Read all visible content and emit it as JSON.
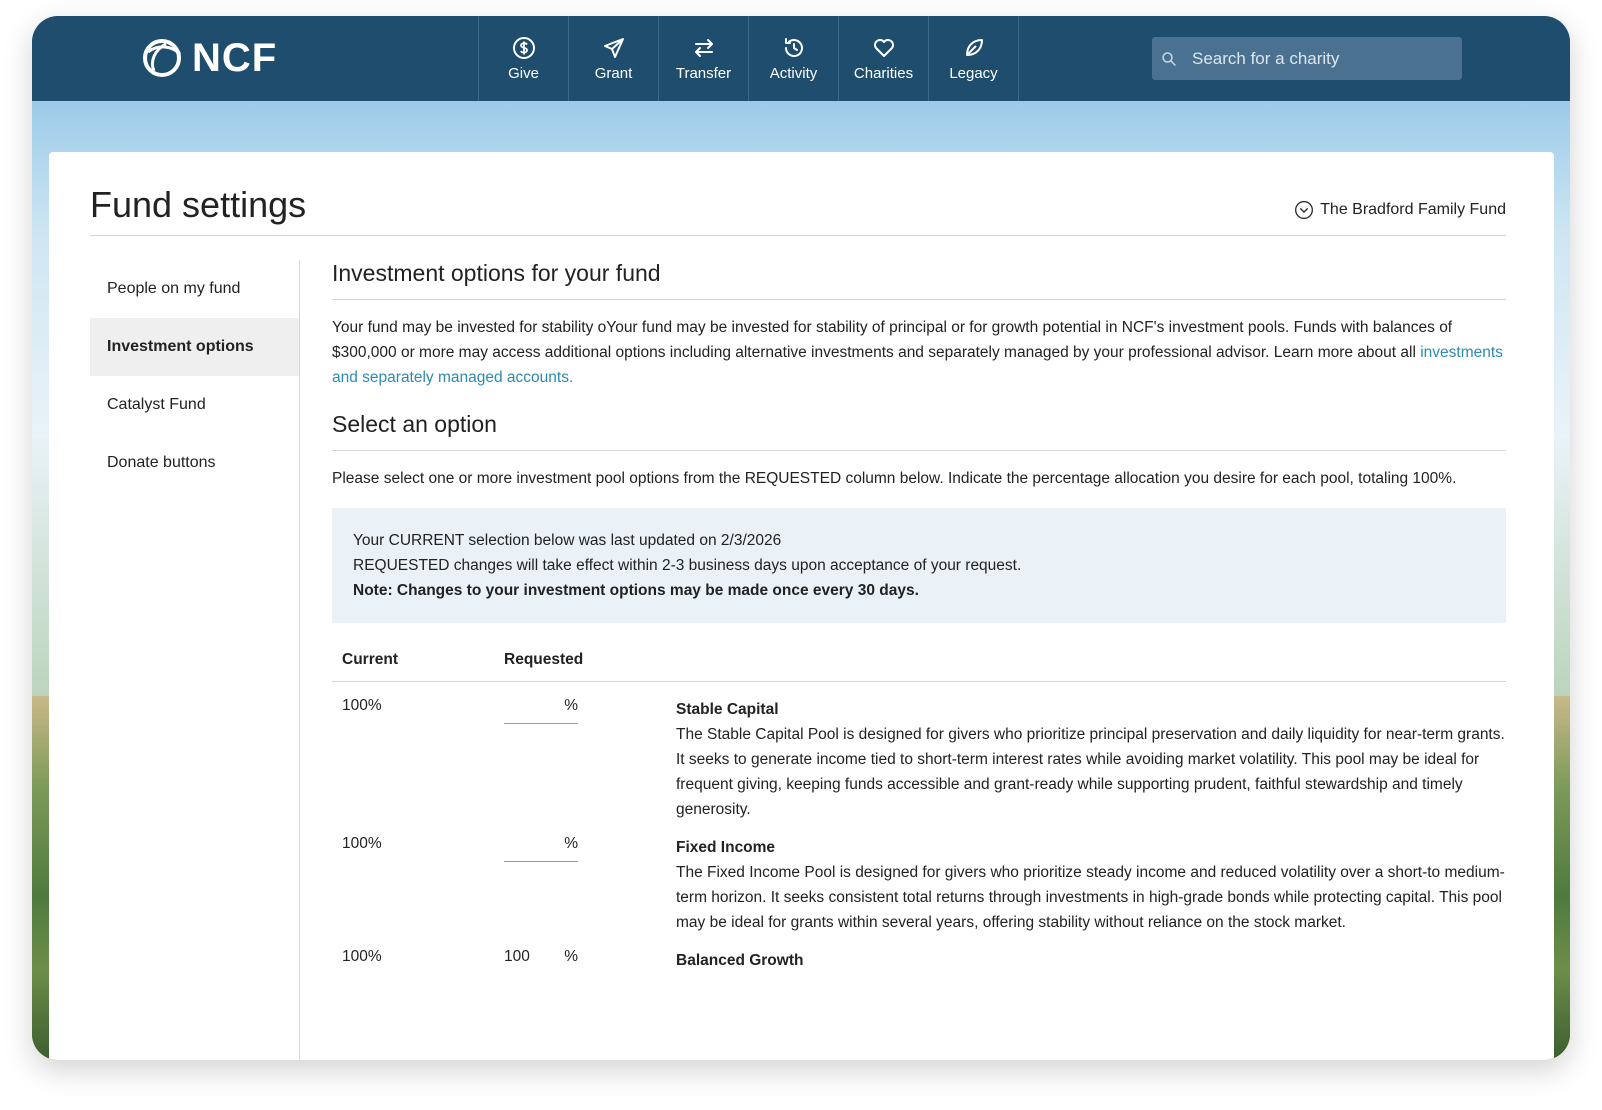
{
  "nav": {
    "logo_text": "NCF",
    "items": [
      {
        "label": "Give",
        "icon": "dollar-circle-icon"
      },
      {
        "label": "Grant",
        "icon": "send-icon"
      },
      {
        "label": "Transfer",
        "icon": "transfer-arrows-icon"
      },
      {
        "label": "Activity",
        "icon": "history-icon"
      },
      {
        "label": "Charities",
        "icon": "heart-icon"
      },
      {
        "label": "Legacy",
        "icon": "leaf-icon"
      }
    ],
    "search_placeholder": "Search for a charity"
  },
  "page": {
    "title": "Fund settings",
    "fund_name": "The Bradford Family Fund"
  },
  "sidebar": {
    "items": [
      {
        "label": "People on my fund",
        "active": false
      },
      {
        "label": "Investment options",
        "active": true
      },
      {
        "label": "Catalyst Fund",
        "active": false
      },
      {
        "label": "Donate buttons",
        "active": false
      }
    ]
  },
  "main": {
    "heading": "Investment options for your fund",
    "intro": "Your fund may be invested for stability oYour fund may be invested for stability of principal or for growth potential in NCF's investment pools. Funds with balances of $300,000 or more may access additional options including alternative investments and separately managed by your professional advisor. Learn more about all ",
    "intro_link": "investments and separately managed accounts.",
    "select_heading": "Select an option",
    "select_text": "Please select one or more investment pool options from the REQUESTED column below. Indicate the percentage allocation you desire for each pool, totaling 100%.",
    "notice_line1": "Your CURRENT selection below was last updated on 2/3/2026",
    "notice_line2": "REQUESTED changes will take effect within 2-3 business days upon acceptance of your request.",
    "notice_note": "Note: Changes to your investment options may be made once every 30 days.",
    "col_current": "Current",
    "col_requested": "Requested",
    "pools": [
      {
        "current": "100%",
        "requested": "",
        "unit": "%",
        "name": "Stable Capital",
        "description": "The Stable Capital Pool is designed for givers who prioritize principal preservation and daily liquidity for near-term grants. It seeks to generate income tied to short-term interest rates while avoiding market volatility. This pool may be ideal for frequent giving, keeping funds accessible and grant-ready while supporting prudent, faithful stewardship and timely generosity."
      },
      {
        "current": "100%",
        "requested": "",
        "unit": "%",
        "name": "Fixed Income",
        "description": "The Fixed Income Pool is designed for givers who prioritize steady income and reduced volatility over a short-to medium-term horizon. It seeks consistent total returns through investments in high-grade bonds while protecting capital. This pool may be ideal for grants within several years, offering stability without reliance on the stock market."
      },
      {
        "current": "100%",
        "requested": "100",
        "unit": "%",
        "name": "Balanced Growth",
        "description": ""
      }
    ]
  }
}
